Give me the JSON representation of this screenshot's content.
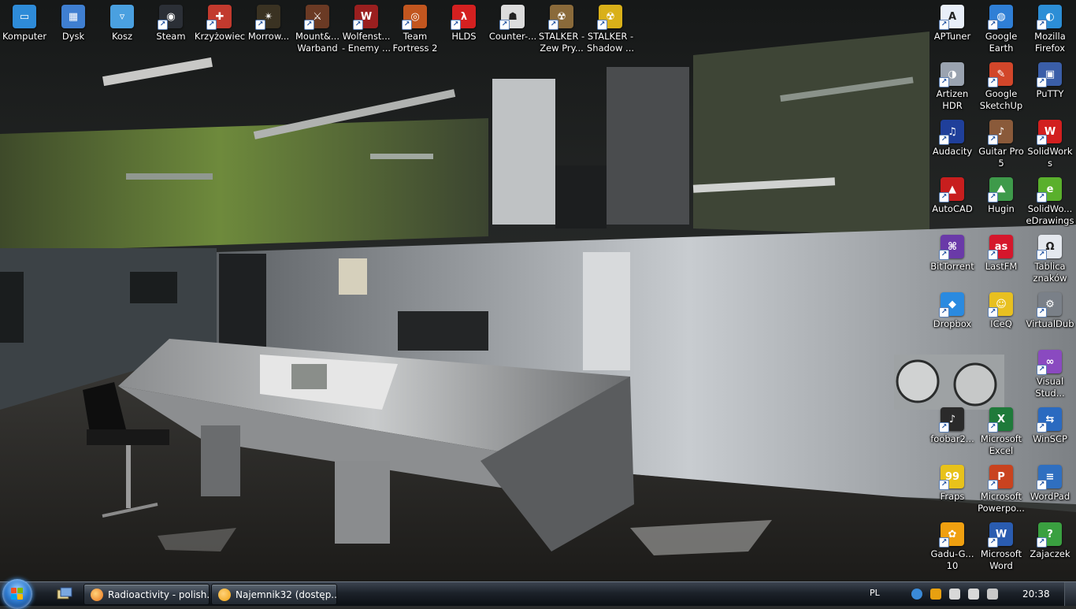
{
  "desktop": {
    "icons": [
      {
        "label": "Komputer",
        "icon": "computer-icon",
        "color": "#2e8bd8",
        "glyph": "▭",
        "shortcut": false
      },
      {
        "label": "Dysk",
        "icon": "drive-icon",
        "color": "#3f7fd1",
        "glyph": "▦",
        "shortcut": false
      },
      {
        "label": "Kosz",
        "icon": "recycle-bin-icon",
        "color": "#4aa0e0",
        "glyph": "▿",
        "shortcut": false
      },
      {
        "label": "Steam",
        "icon": "steam-icon",
        "color": "#2b2f36",
        "glyph": "◉",
        "shortcut": true
      },
      {
        "label": "Krzyżowiec",
        "icon": "crusader-shield-icon",
        "color": "#c23a2e",
        "glyph": "✚",
        "shortcut": true
      },
      {
        "label": "Morrow...",
        "icon": "morrowind-icon",
        "color": "#3a3222",
        "glyph": "✴",
        "shortcut": true
      },
      {
        "label": "Mount&...\nWarband",
        "icon": "mount-blade-icon",
        "color": "#6b3a24",
        "glyph": "⚔",
        "shortcut": true
      },
      {
        "label": "Wolfenst...\n- Enemy ...",
        "icon": "wolfenstein-icon",
        "color": "#9a1f1f",
        "glyph": "W",
        "shortcut": true
      },
      {
        "label": "Team\nFortress 2",
        "icon": "team-fortress-icon",
        "color": "#c2561f",
        "glyph": "◎",
        "shortcut": true
      },
      {
        "label": "HLDS",
        "icon": "hlds-icon",
        "color": "#d42020",
        "glyph": "λ",
        "shortcut": true
      },
      {
        "label": "Counter-...",
        "icon": "counter-strike-icon",
        "color": "#dcdcdc",
        "glyph": "☗",
        "shortcut": true
      },
      {
        "label": "STALKER -\nZew Pry...",
        "icon": "stalker-radiation-icon",
        "color": "#8a6a3a",
        "glyph": "☢",
        "shortcut": true
      },
      {
        "label": "STALKER -\nShadow ...",
        "icon": "stalker-shadow-icon",
        "color": "#d9b019",
        "glyph": "☢",
        "shortcut": true
      },
      {
        "label": "APTuner",
        "icon": "aptuner-icon",
        "color": "#e8eef8",
        "glyph": "A",
        "shortcut": true
      },
      {
        "label": "Google\nEarth",
        "icon": "google-earth-icon",
        "color": "#2f7fd6",
        "glyph": "◍",
        "shortcut": true
      },
      {
        "label": "Mozilla\nFirefox",
        "icon": "firefox-icon",
        "color": "#2c8ed6",
        "glyph": "◐",
        "shortcut": true
      },
      {
        "label": "Artizen\nHDR",
        "icon": "artizen-hdr-icon",
        "color": "#9aa3b0",
        "glyph": "◑",
        "shortcut": true
      },
      {
        "label": "Google\nSketchUp",
        "icon": "sketchup-icon",
        "color": "#d2462a",
        "glyph": "✎",
        "shortcut": true
      },
      {
        "label": "PuTTY",
        "icon": "putty-icon",
        "color": "#3a5ea8",
        "glyph": "▣",
        "shortcut": true
      },
      {
        "label": "Audacity",
        "icon": "audacity-icon",
        "color": "#1f3f9a",
        "glyph": "♫",
        "shortcut": true
      },
      {
        "label": "Guitar Pro\n5",
        "icon": "guitar-pro-icon",
        "color": "#8a5a3a",
        "glyph": "♪",
        "shortcut": true
      },
      {
        "label": "SolidWork\ns",
        "icon": "solidworks-icon",
        "color": "#d21f1f",
        "glyph": "W",
        "shortcut": true
      },
      {
        "label": "AutoCAD",
        "icon": "autocad-icon",
        "color": "#c81e1e",
        "glyph": "▲",
        "shortcut": true
      },
      {
        "label": "Hugin",
        "icon": "hugin-icon",
        "color": "#3e9a4a",
        "glyph": "⛰",
        "shortcut": true
      },
      {
        "label": "SolidWo...\neDrawings",
        "icon": "edrawings-icon",
        "color": "#5ab02c",
        "glyph": "e",
        "shortcut": true
      },
      {
        "label": "BitTorrent",
        "icon": "bittorrent-icon",
        "color": "#6a3aa8",
        "glyph": "⌘",
        "shortcut": true
      },
      {
        "label": "LastFM",
        "icon": "lastfm-icon",
        "color": "#d5172c",
        "glyph": "as",
        "shortcut": true
      },
      {
        "label": "Tablica\nznaków",
        "icon": "character-map-icon",
        "color": "#e4e8ee",
        "glyph": "Ω",
        "shortcut": true
      },
      {
        "label": "Dropbox",
        "icon": "dropbox-icon",
        "color": "#2a8ae0",
        "glyph": "◆",
        "shortcut": true
      },
      {
        "label": "ICeQ",
        "icon": "iceq-icon",
        "color": "#e8c020",
        "glyph": "☺",
        "shortcut": true
      },
      {
        "label": "VirtualDub",
        "icon": "virtualdub-icon",
        "color": "#7a8088",
        "glyph": "⚙",
        "shortcut": true
      },
      {
        "label": "Visual\nStud...",
        "icon": "visual-studio-icon",
        "color": "#8a4ac0",
        "glyph": "∞",
        "shortcut": true
      },
      {
        "label": "foobar2...",
        "icon": "foobar2000-icon",
        "color": "#2a2a2a",
        "glyph": "♪",
        "shortcut": true
      },
      {
        "label": "Microsoft\nExcel",
        "icon": "excel-icon",
        "color": "#1f7a3a",
        "glyph": "X",
        "shortcut": true
      },
      {
        "label": "WinSCP",
        "icon": "winscp-icon",
        "color": "#2a6ac0",
        "glyph": "⇆",
        "shortcut": true
      },
      {
        "label": "Fraps",
        "icon": "fraps-icon",
        "color": "#e8c21a",
        "glyph": "99",
        "shortcut": true
      },
      {
        "label": "Microsoft\nPowerpo...",
        "icon": "powerpoint-icon",
        "color": "#c9431f",
        "glyph": "P",
        "shortcut": true
      },
      {
        "label": "WordPad",
        "icon": "wordpad-icon",
        "color": "#2f6fc0",
        "glyph": "≡",
        "shortcut": true
      },
      {
        "label": "Gadu-G...\n10",
        "icon": "gadu-gadu-icon",
        "color": "#f0a010",
        "glyph": "✿",
        "shortcut": true
      },
      {
        "label": "Microsoft\nWord",
        "icon": "word-icon",
        "color": "#2a5cb0",
        "glyph": "W",
        "shortcut": true
      },
      {
        "label": "Zajaczek",
        "icon": "zajaczek-icon",
        "color": "#3aa040",
        "glyph": "?",
        "shortcut": true
      }
    ]
  },
  "taskbar": {
    "start_label": "Start",
    "quick_launch_icon": "show-desktop-icon",
    "tasks": [
      {
        "title": "Radioactivity - polish...",
        "icon": "firefox-icon",
        "color": "#e8731c"
      },
      {
        "title": "Najemnik32 (dostęp...",
        "icon": "gadu-gadu-icon",
        "color": "#f0a010"
      }
    ],
    "tray": {
      "language": "PL",
      "icons": [
        {
          "icon": "network-globe-icon",
          "color": "#3a8ad8"
        },
        {
          "icon": "gadu-gadu-tray-icon",
          "color": "#e8a010"
        },
        {
          "icon": "volume-icon",
          "color": "#d8d8d8"
        },
        {
          "icon": "safely-remove-icon",
          "color": "#d8d8d8"
        },
        {
          "icon": "steam-tray-icon",
          "color": "#c8c8c8"
        }
      ],
      "clock": "20:38"
    }
  }
}
